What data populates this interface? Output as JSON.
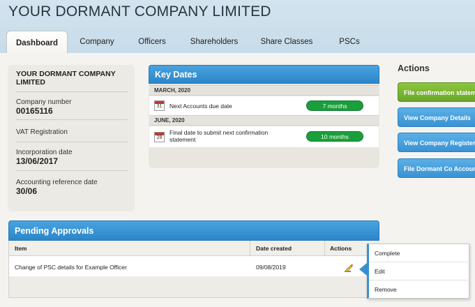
{
  "company": {
    "title": "YOUR DORMANT COMPANY LIMITED"
  },
  "tabs": [
    {
      "label": "Dashboard",
      "active": true
    },
    {
      "label": "Company"
    },
    {
      "label": "Officers"
    },
    {
      "label": "Shareholders"
    },
    {
      "label": "Share Classes"
    },
    {
      "label": "PSCs"
    }
  ],
  "info": {
    "name": "YOUR DORMANT COMPANY LIMITED",
    "company_number_label": "Company number",
    "company_number": "00165116",
    "vat_label": "VAT Registration",
    "incorporation_label": "Incorporation date",
    "incorporation_date": "13/06/2017",
    "accounting_label": "Accounting reference date",
    "accounting_date": "30/06"
  },
  "key_dates": {
    "title": "Key Dates",
    "groups": [
      {
        "month": "MARCH, 2020",
        "day": "31",
        "text": "Next Accounts due date",
        "badge": "7 months"
      },
      {
        "month": "JUNE, 2020",
        "day": "28",
        "text": "Final date to submit next confirmation statement",
        "badge": "10 months"
      }
    ]
  },
  "actions": {
    "title": "Actions",
    "buttons": [
      {
        "label": "File confirmation statement",
        "color": "#7cb934"
      },
      {
        "label": "View Company Details",
        "color": "#4aa3df"
      },
      {
        "label": "View Company Register",
        "color": "#4aa3df"
      },
      {
        "label": "File Dormant Co Accounts",
        "color": "#4aa3df"
      }
    ]
  },
  "pending": {
    "title": "Pending Approvals",
    "columns": {
      "item": "Item",
      "date": "Date created",
      "actions": "Actions"
    },
    "rows": [
      {
        "item": "Change of PSC details for Example Officer",
        "date": "09/08/2019"
      }
    ]
  },
  "menu": {
    "items": [
      "Complete",
      "Edit",
      "Remove"
    ]
  },
  "icons": {
    "calendar": "calendar-icon",
    "edit": "edit-pencil-icon"
  }
}
